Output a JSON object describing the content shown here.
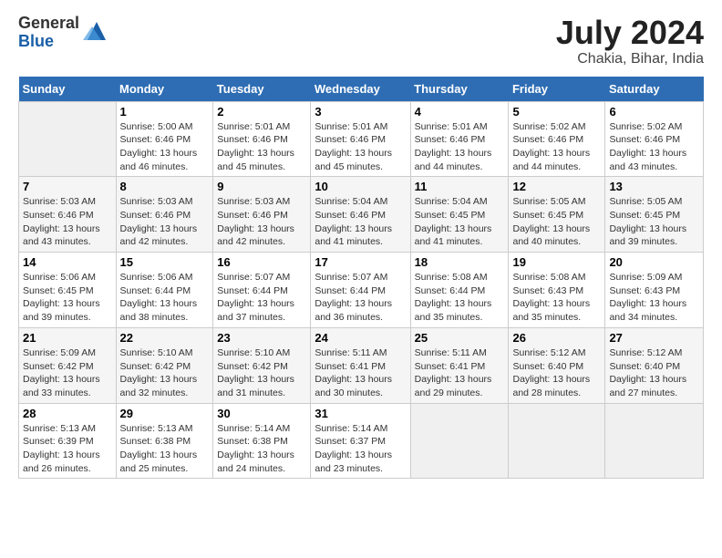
{
  "header": {
    "logo_general": "General",
    "logo_blue": "Blue",
    "month_title": "July 2024",
    "location": "Chakia, Bihar, India"
  },
  "days_of_week": [
    "Sunday",
    "Monday",
    "Tuesday",
    "Wednesday",
    "Thursday",
    "Friday",
    "Saturday"
  ],
  "weeks": [
    [
      {
        "day": "",
        "info": ""
      },
      {
        "day": "1",
        "info": "Sunrise: 5:00 AM\nSunset: 6:46 PM\nDaylight: 13 hours\nand 46 minutes."
      },
      {
        "day": "2",
        "info": "Sunrise: 5:01 AM\nSunset: 6:46 PM\nDaylight: 13 hours\nand 45 minutes."
      },
      {
        "day": "3",
        "info": "Sunrise: 5:01 AM\nSunset: 6:46 PM\nDaylight: 13 hours\nand 45 minutes."
      },
      {
        "day": "4",
        "info": "Sunrise: 5:01 AM\nSunset: 6:46 PM\nDaylight: 13 hours\nand 44 minutes."
      },
      {
        "day": "5",
        "info": "Sunrise: 5:02 AM\nSunset: 6:46 PM\nDaylight: 13 hours\nand 44 minutes."
      },
      {
        "day": "6",
        "info": "Sunrise: 5:02 AM\nSunset: 6:46 PM\nDaylight: 13 hours\nand 43 minutes."
      }
    ],
    [
      {
        "day": "7",
        "info": "Sunrise: 5:03 AM\nSunset: 6:46 PM\nDaylight: 13 hours\nand 43 minutes."
      },
      {
        "day": "8",
        "info": "Sunrise: 5:03 AM\nSunset: 6:46 PM\nDaylight: 13 hours\nand 42 minutes."
      },
      {
        "day": "9",
        "info": "Sunrise: 5:03 AM\nSunset: 6:46 PM\nDaylight: 13 hours\nand 42 minutes."
      },
      {
        "day": "10",
        "info": "Sunrise: 5:04 AM\nSunset: 6:46 PM\nDaylight: 13 hours\nand 41 minutes."
      },
      {
        "day": "11",
        "info": "Sunrise: 5:04 AM\nSunset: 6:45 PM\nDaylight: 13 hours\nand 41 minutes."
      },
      {
        "day": "12",
        "info": "Sunrise: 5:05 AM\nSunset: 6:45 PM\nDaylight: 13 hours\nand 40 minutes."
      },
      {
        "day": "13",
        "info": "Sunrise: 5:05 AM\nSunset: 6:45 PM\nDaylight: 13 hours\nand 39 minutes."
      }
    ],
    [
      {
        "day": "14",
        "info": "Sunrise: 5:06 AM\nSunset: 6:45 PM\nDaylight: 13 hours\nand 39 minutes."
      },
      {
        "day": "15",
        "info": "Sunrise: 5:06 AM\nSunset: 6:44 PM\nDaylight: 13 hours\nand 38 minutes."
      },
      {
        "day": "16",
        "info": "Sunrise: 5:07 AM\nSunset: 6:44 PM\nDaylight: 13 hours\nand 37 minutes."
      },
      {
        "day": "17",
        "info": "Sunrise: 5:07 AM\nSunset: 6:44 PM\nDaylight: 13 hours\nand 36 minutes."
      },
      {
        "day": "18",
        "info": "Sunrise: 5:08 AM\nSunset: 6:44 PM\nDaylight: 13 hours\nand 35 minutes."
      },
      {
        "day": "19",
        "info": "Sunrise: 5:08 AM\nSunset: 6:43 PM\nDaylight: 13 hours\nand 35 minutes."
      },
      {
        "day": "20",
        "info": "Sunrise: 5:09 AM\nSunset: 6:43 PM\nDaylight: 13 hours\nand 34 minutes."
      }
    ],
    [
      {
        "day": "21",
        "info": "Sunrise: 5:09 AM\nSunset: 6:42 PM\nDaylight: 13 hours\nand 33 minutes."
      },
      {
        "day": "22",
        "info": "Sunrise: 5:10 AM\nSunset: 6:42 PM\nDaylight: 13 hours\nand 32 minutes."
      },
      {
        "day": "23",
        "info": "Sunrise: 5:10 AM\nSunset: 6:42 PM\nDaylight: 13 hours\nand 31 minutes."
      },
      {
        "day": "24",
        "info": "Sunrise: 5:11 AM\nSunset: 6:41 PM\nDaylight: 13 hours\nand 30 minutes."
      },
      {
        "day": "25",
        "info": "Sunrise: 5:11 AM\nSunset: 6:41 PM\nDaylight: 13 hours\nand 29 minutes."
      },
      {
        "day": "26",
        "info": "Sunrise: 5:12 AM\nSunset: 6:40 PM\nDaylight: 13 hours\nand 28 minutes."
      },
      {
        "day": "27",
        "info": "Sunrise: 5:12 AM\nSunset: 6:40 PM\nDaylight: 13 hours\nand 27 minutes."
      }
    ],
    [
      {
        "day": "28",
        "info": "Sunrise: 5:13 AM\nSunset: 6:39 PM\nDaylight: 13 hours\nand 26 minutes."
      },
      {
        "day": "29",
        "info": "Sunrise: 5:13 AM\nSunset: 6:38 PM\nDaylight: 13 hours\nand 25 minutes."
      },
      {
        "day": "30",
        "info": "Sunrise: 5:14 AM\nSunset: 6:38 PM\nDaylight: 13 hours\nand 24 minutes."
      },
      {
        "day": "31",
        "info": "Sunrise: 5:14 AM\nSunset: 6:37 PM\nDaylight: 13 hours\nand 23 minutes."
      },
      {
        "day": "",
        "info": ""
      },
      {
        "day": "",
        "info": ""
      },
      {
        "day": "",
        "info": ""
      }
    ]
  ]
}
